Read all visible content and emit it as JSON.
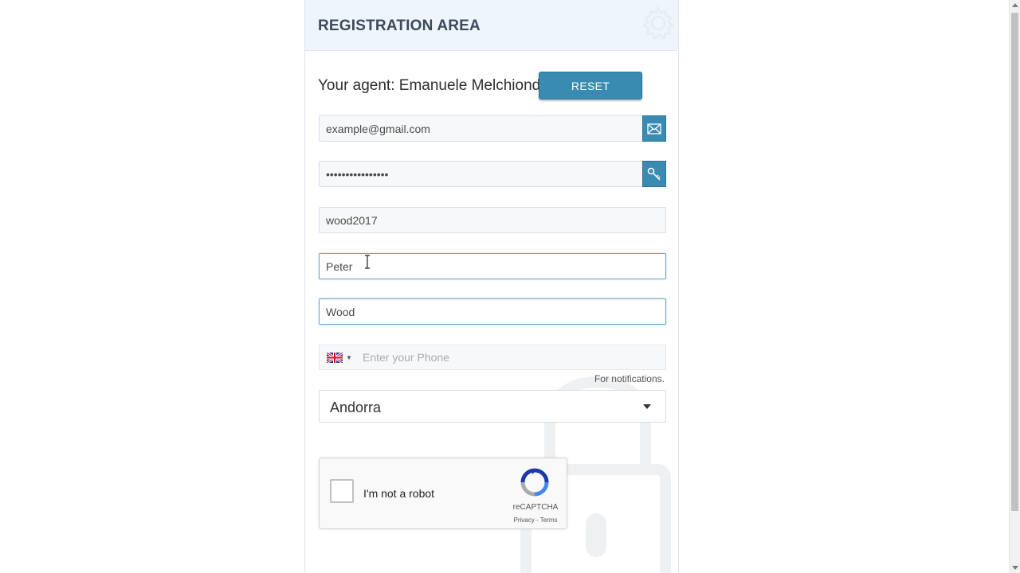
{
  "panel": {
    "title": "REGISTRATION AREA"
  },
  "agent": {
    "label": "Your agent: Emanuele Melchionda",
    "reset_label": "RESET"
  },
  "form": {
    "email_value": "example@gmail.com",
    "password_value": "••••••••••••••••",
    "username_value": "wood2017",
    "first_name_value": "Peter",
    "last_name_value": "Wood",
    "phone_placeholder": "Enter your Phone",
    "phone_hint": "For notifications.",
    "country_selected": "Andorra"
  },
  "captcha": {
    "label": "I'm not a robot",
    "brand": "reCAPTCHA",
    "privacy": "Privacy",
    "separator": " - ",
    "terms": "Terms"
  },
  "icons": {
    "header": "gear-icon",
    "email_addon": "envelope-icon",
    "password_addon": "key-icon",
    "phone_flag": "uk-flag-icon"
  },
  "colors": {
    "accent": "#3a8bb1",
    "header_bg": "#eef5fc",
    "focus_border": "#6fa0c9"
  }
}
